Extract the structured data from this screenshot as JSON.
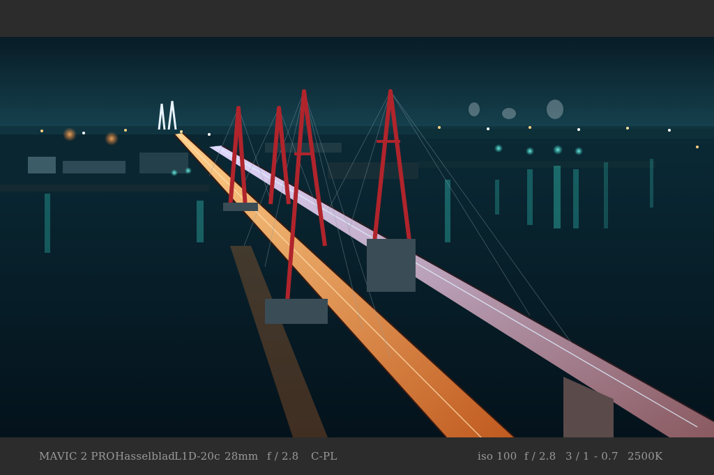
{
  "caption": {
    "left": [
      {
        "id": "drone",
        "text": "MAVIC 2 PRO"
      },
      {
        "id": "brand",
        "text": "Hasselblad"
      },
      {
        "id": "camera",
        "text": "L1D-20c"
      },
      {
        "id": "focal",
        "text": "28mm"
      },
      {
        "id": "aperture",
        "text": "f / 2.8"
      },
      {
        "id": "filter",
        "text": "C-PL"
      }
    ],
    "right": [
      {
        "id": "iso",
        "text": "iso 100"
      },
      {
        "id": "aperture2",
        "text": "f / 2.8"
      },
      {
        "id": "shutter",
        "text": "3 / 1"
      },
      {
        "id": "ev",
        "text": "- 0.7"
      },
      {
        "id": "wb",
        "text": "2500K"
      }
    ]
  },
  "colors": {
    "frame": "#2c2c2c",
    "sky": "#0b2a36",
    "water": "#061a26",
    "tower": "#b0242c",
    "deck_light": "#f0a050",
    "city_cyan": "#3ff2e0"
  }
}
